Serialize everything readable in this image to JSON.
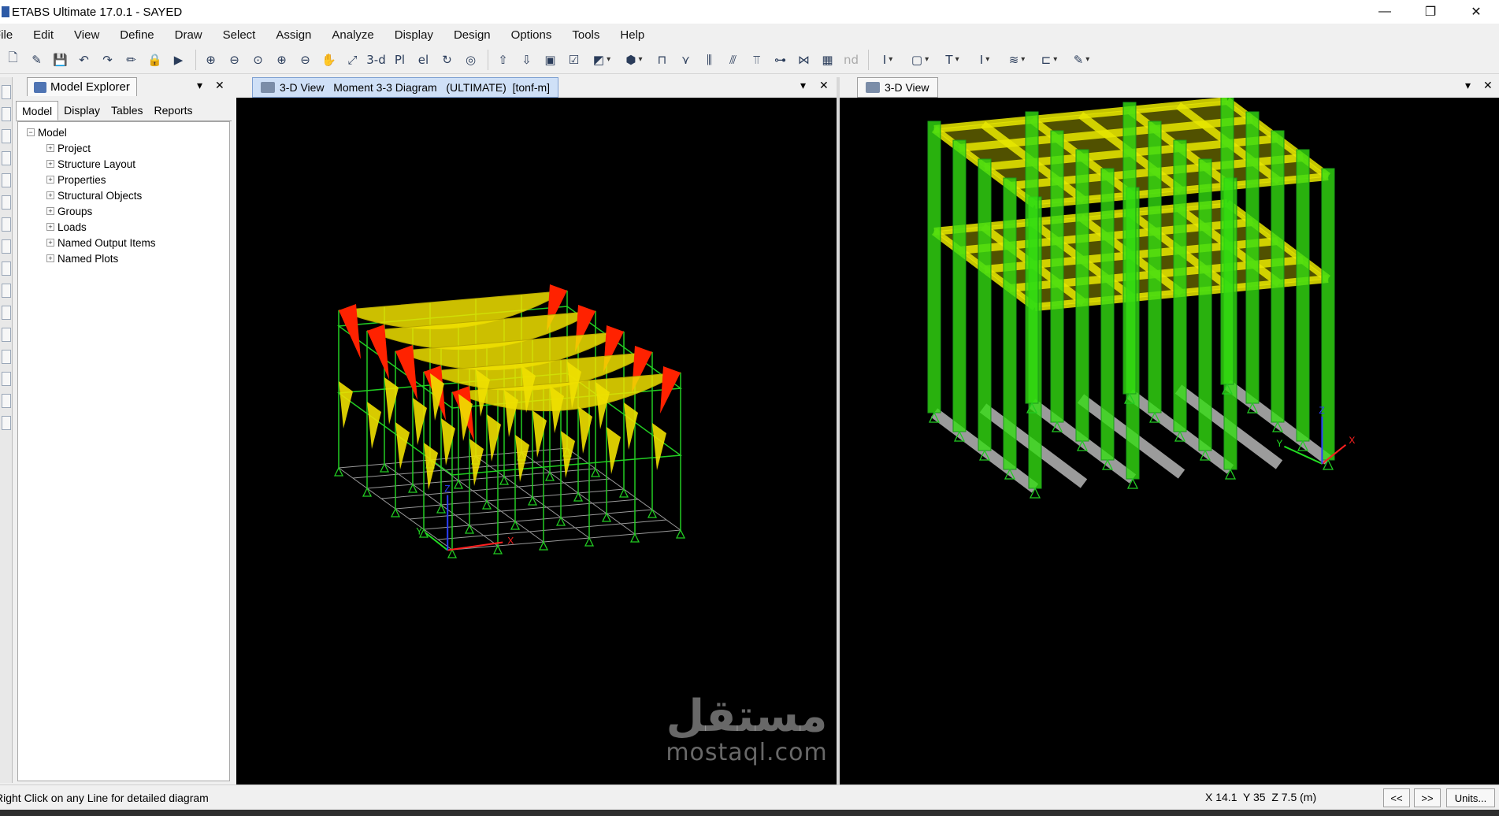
{
  "window": {
    "title": "ETABS Ultimate 17.0.1 - SAYED",
    "controls": [
      "—",
      "❐",
      "✕"
    ]
  },
  "menu": [
    "File",
    "Edit",
    "View",
    "Define",
    "Draw",
    "Select",
    "Assign",
    "Analyze",
    "Display",
    "Design",
    "Options",
    "Tools",
    "Help"
  ],
  "toolbar": {
    "view_3d": "3-d",
    "plan": "Pl",
    "elev": "el",
    "nd": "nd"
  },
  "explorer": {
    "title": "Model Explorer",
    "tabs": [
      "Model",
      "Display",
      "Tables",
      "Reports"
    ],
    "active_tab": "Model",
    "root": "Model",
    "items": [
      "Project",
      "Structure Layout",
      "Properties",
      "Structural Objects",
      "Groups",
      "Loads",
      "Named Output Items",
      "Named Plots"
    ]
  },
  "views": {
    "left_tab": "3-D View   Moment 3-3 Diagram   (ULTIMATE)  [tonf-m]",
    "right_tab": "3-D View"
  },
  "axes": {
    "x": "X",
    "y": "Y",
    "z": "Z"
  },
  "colors": {
    "frame": "#22cc22",
    "moment_positive": "#f0e000",
    "moment_negative": "#ff2200",
    "grid": "#9a9a9a",
    "beam_model": "#e8e800",
    "column_model": "#33dd11",
    "footing": "#9b9b9b",
    "canvas": "#000000"
  },
  "status": {
    "message": "Right Click on any Line for detailed diagram",
    "coords": "X 14.1  Y 35  Z 7.5 (m)",
    "prev": "<<",
    "next": ">>",
    "units": "Units..."
  },
  "watermark": {
    "arabic": "مستقل",
    "latin": "mostaql.com"
  }
}
